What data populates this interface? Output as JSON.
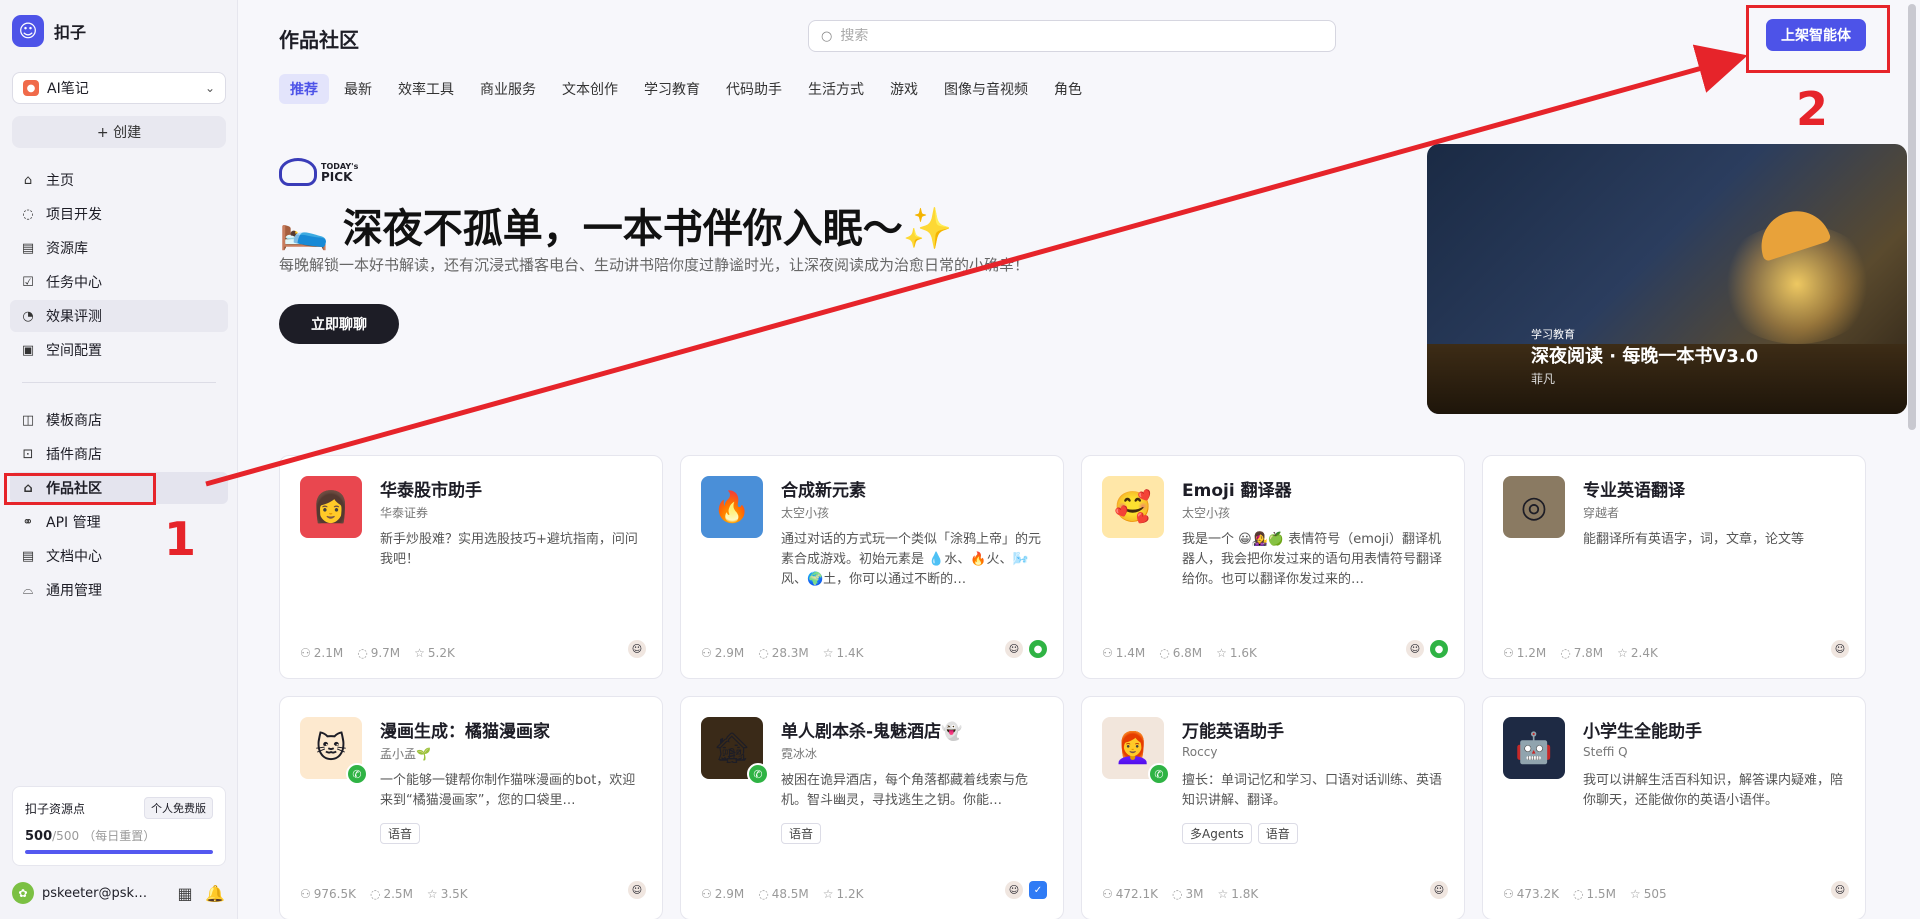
{
  "brand": {
    "name": "扣子"
  },
  "sidebar": {
    "space": "AI笔记",
    "create_label": "+ 创建",
    "nav_top": [
      {
        "label": "主页",
        "icon": "home-icon",
        "glyph": "⌂"
      },
      {
        "label": "项目开发",
        "icon": "project-icon",
        "glyph": "◌"
      },
      {
        "label": "资源库",
        "icon": "library-icon",
        "glyph": "▤"
      },
      {
        "label": "任务中心",
        "icon": "task-icon",
        "glyph": "☑"
      },
      {
        "label": "效果评测",
        "icon": "evaluation-icon",
        "glyph": "◔"
      },
      {
        "label": "空间配置",
        "icon": "space-config-icon",
        "glyph": "▣"
      }
    ],
    "nav_bottom": [
      {
        "label": "模板商店",
        "icon": "template-store-icon",
        "glyph": "◫"
      },
      {
        "label": "插件商店",
        "icon": "plugin-store-icon",
        "glyph": "⊡"
      },
      {
        "label": "作品社区",
        "icon": "community-icon",
        "glyph": "⌂"
      },
      {
        "label": "API 管理",
        "icon": "api-icon",
        "glyph": "⚭"
      },
      {
        "label": "文档中心",
        "icon": "docs-icon",
        "glyph": "▤"
      },
      {
        "label": "通用管理",
        "icon": "manage-icon",
        "glyph": "⌓"
      }
    ],
    "resource": {
      "title": "扣子资源点",
      "badge": "个人免费版",
      "value": "500",
      "total": "/500",
      "note": "（每日重置）",
      "progress": 1.0
    },
    "user": {
      "name": "pskeeter@psk…"
    }
  },
  "header": {
    "title": "作品社区",
    "search_placeholder": "搜索",
    "publish_label": "上架智能体"
  },
  "tabs": [
    "推荐",
    "最新",
    "效率工具",
    "商业服务",
    "文本创作",
    "学习教育",
    "代码助手",
    "生活方式",
    "游戏",
    "图像与音视频",
    "角色"
  ],
  "hero": {
    "pick_line1": "TODAY's",
    "pick_line2": "PICK",
    "title": "🛌 深夜不孤单，一本书伴你入眠～✨",
    "subtitle": "每晚解锁一本好书解读，还有沉浸式播客电台、生动讲书陪你度过静谧时光，让深夜阅读成为治愈日常的小确幸！",
    "button": "立即聊聊",
    "card_category": "学习教育",
    "card_title": "深夜阅读 · 每晚一本书V3.0",
    "card_author": "菲凡"
  },
  "cards": [
    {
      "title": "华泰股市助手",
      "author": "华泰证券",
      "desc": "新手炒股难？实用选股技巧+避坑指南，问问我吧！",
      "tags": [],
      "users": "2.1M",
      "chats": "9.7M",
      "stars": "5.2K",
      "avatar": "👩",
      "bg": "#e9474f",
      "phone": false
    },
    {
      "title": "合成新元素",
      "author": "太空小孩",
      "desc": "通过对话的方式玩一个类似「涂鸦上帝」的元素合成游戏。初始元素是 💧水、🔥火、🌬️风、🌍土，你可以通过不断的…",
      "tags": [],
      "users": "2.9M",
      "chats": "28.3M",
      "stars": "1.4K",
      "avatar": "🔥",
      "bg": "#4a8fd8",
      "phone": false
    },
    {
      "title": "Emoji 翻译器",
      "author": "太空小孩",
      "desc": "我是一个 😀👩‍🎤🍏 表情符号（emoji）翻译机器人，我会把你发过来的语句用表情符号翻译给你。也可以翻译你发过来的…",
      "tags": [],
      "users": "1.4M",
      "chats": "6.8M",
      "stars": "1.6K",
      "avatar": "🥰",
      "bg": "#ffe7a8",
      "phone": false
    },
    {
      "title": "专业英语翻译",
      "author": "穿越者",
      "desc": "能翻译所有英语字，词，文章，论文等",
      "tags": [],
      "users": "1.2M",
      "chats": "7.8M",
      "stars": "2.4K",
      "avatar": "◎",
      "bg": "#8a7a62",
      "phone": false
    },
    {
      "title": "漫画生成：橘猫漫画家",
      "author": "孟小孟🌱",
      "desc": "一个能够一键帮你制作猫咪漫画的bot，欢迎来到“橘猫漫画家”，您的口袋里…",
      "tags": [
        "语音"
      ],
      "users": "976.5K",
      "chats": "2.5M",
      "stars": "3.5K",
      "avatar": "🐱",
      "bg": "#fde9cf",
      "phone": true
    },
    {
      "title": "单人剧本杀-鬼魅酒店👻",
      "author": "霓冰冰",
      "desc": "被困在诡异酒店，每个角落都藏着线索与危机。智斗幽灵，寻找逃生之钥。你能…",
      "tags": [
        "语音"
      ],
      "users": "2.9M",
      "chats": "48.5M",
      "stars": "1.2K",
      "avatar": "🏚",
      "bg": "#3a2a18",
      "phone": true
    },
    {
      "title": "万能英语助手",
      "author": "Roccy",
      "desc": "擅长：单词记忆和学习、口语对话训练、英语知识讲解、翻译。",
      "tags": [
        "多Agents",
        "语音"
      ],
      "users": "472.1K",
      "chats": "3M",
      "stars": "1.8K",
      "avatar": "👩‍🦰",
      "bg": "#f2e6dc",
      "phone": true
    },
    {
      "title": "小学生全能助手",
      "author": "Steffi Q",
      "desc": "我可以讲解生活百科知识，解答课内疑难，陪你聊天，还能做你的英语小语伴。",
      "tags": [],
      "users": "473.2K",
      "chats": "1.5M",
      "stars": "505",
      "avatar": "🤖",
      "bg": "#1e2a44",
      "phone": false
    }
  ],
  "annotations": {
    "label1": "1",
    "label2": "2"
  },
  "colors": {
    "accent": "#4d53e8",
    "annotation": "#e6242a"
  }
}
